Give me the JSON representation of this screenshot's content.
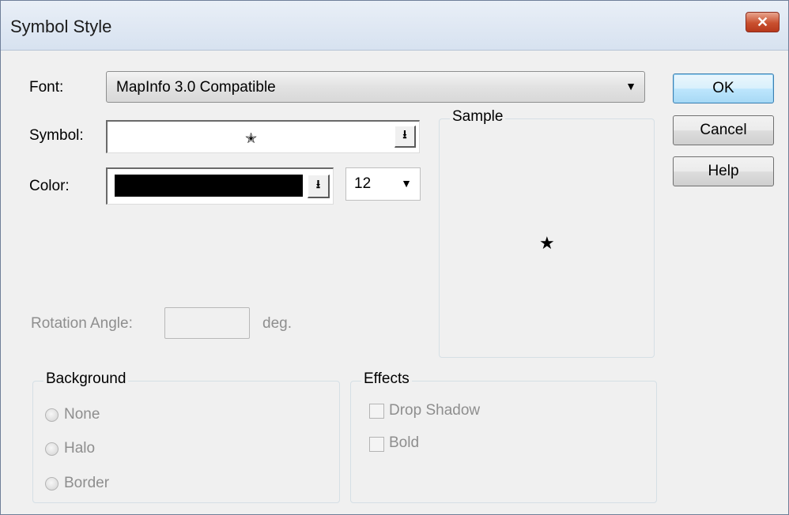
{
  "window": {
    "title": "Symbol Style",
    "close_label": "✕"
  },
  "font": {
    "label": "Font:",
    "value": "MapInfo 3.0 Compatible"
  },
  "symbol": {
    "label": "Symbol:",
    "glyph": "✭"
  },
  "color": {
    "label": "Color:",
    "value": "#000000"
  },
  "size": {
    "value": "12"
  },
  "sample": {
    "title": "Sample",
    "glyph": "★"
  },
  "rotation": {
    "label": "Rotation Angle:",
    "value": "",
    "unit": "deg."
  },
  "background": {
    "title": "Background",
    "options": [
      "None",
      "Halo",
      "Border"
    ]
  },
  "effects": {
    "title": "Effects",
    "options": [
      "Drop Shadow",
      "Bold"
    ]
  },
  "buttons": {
    "ok": "OK",
    "cancel": "Cancel",
    "help": "Help"
  },
  "icons": {
    "dropdown_arrow": "▼",
    "dropdown_button": "⭳"
  }
}
